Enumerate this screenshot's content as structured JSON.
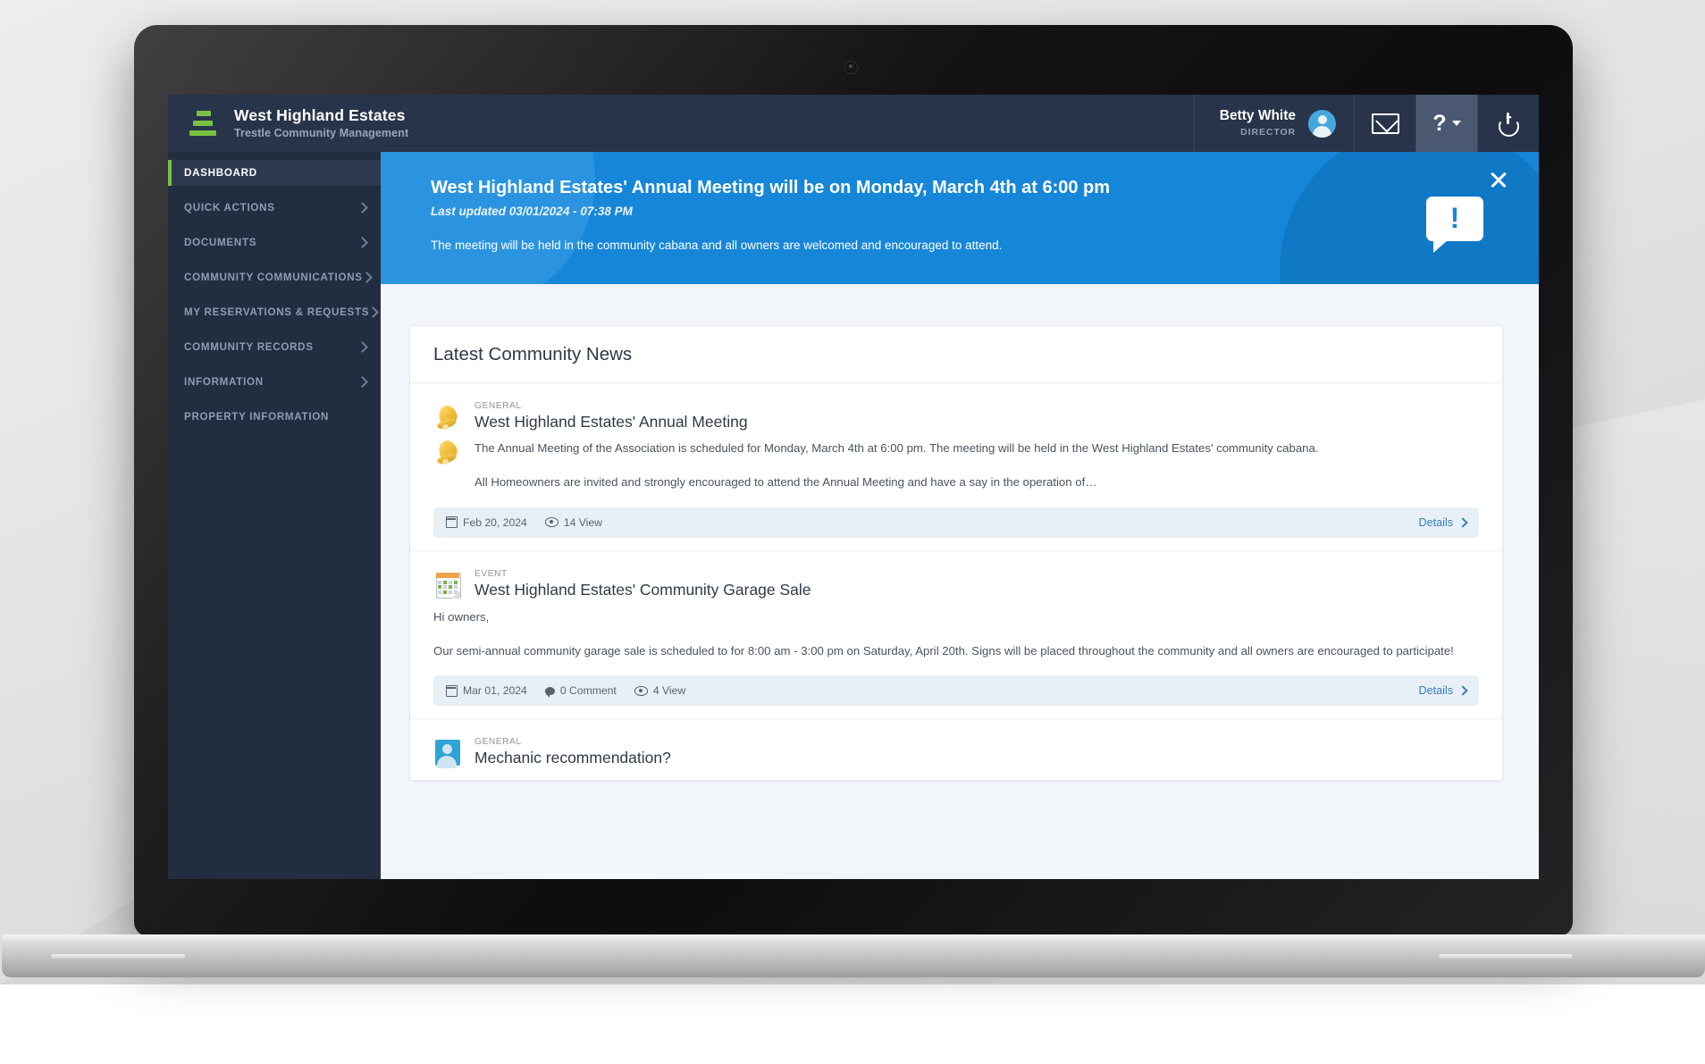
{
  "header": {
    "brand_title": "West Highland Estates",
    "brand_subtitle": "Trestle Community Management",
    "logo_icon": "trestle-bars-logo",
    "user_name": "Betty White",
    "user_role": "DIRECTOR",
    "avatar_icon": "user-avatar-icon",
    "mail_icon": "envelope-icon",
    "help_icon": "question-mark-icon",
    "help_caret_icon": "chevron-down-icon",
    "power_icon": "power-icon"
  },
  "sidebar": {
    "items": [
      {
        "label": "DASHBOARD",
        "active": true,
        "has_chevron": false
      },
      {
        "label": "QUICK ACTIONS",
        "active": false,
        "has_chevron": true
      },
      {
        "label": "DOCUMENTS",
        "active": false,
        "has_chevron": true
      },
      {
        "label": "COMMUNITY COMMUNICATIONS",
        "active": false,
        "has_chevron": true
      },
      {
        "label": "MY RESERVATIONS & REQUESTS",
        "active": false,
        "has_chevron": true
      },
      {
        "label": "COMMUNITY RECORDS",
        "active": false,
        "has_chevron": true
      },
      {
        "label": "INFORMATION",
        "active": false,
        "has_chevron": true
      },
      {
        "label": "PROPERTY INFORMATION",
        "active": false,
        "has_chevron": false
      }
    ]
  },
  "banner": {
    "title": "West Highland Estates' Annual Meeting will be on Monday, March 4th at 6:00 pm",
    "subtitle": "Last updated 03/01/2024 - 07:38 PM",
    "body": "The meeting will be held in the community cabana and all owners are welcomed and encouraged to attend.",
    "close_icon": "close-icon",
    "alert_icon": "speech-bubble-exclamation-icon",
    "alert_glyph": "!",
    "accent_color": "#1686d8"
  },
  "news": {
    "card_title": "Latest Community News",
    "articles": [
      {
        "category": "GENERAL",
        "icon": "bell-icon",
        "title": "West Highland Estates' Annual Meeting",
        "para1": "The Annual Meeting of the Association is scheduled for Monday, March 4th at 6:00 pm. The meeting will be held in the West Highland Estates' community cabana.",
        "para2": "All Homeowners are invited and strongly encouraged to attend the Annual Meeting and have a say in the operation of…",
        "date": "Feb 20, 2024",
        "views": "14 View",
        "details_label": "Details"
      },
      {
        "category": "EVENT",
        "icon": "calendar-icon",
        "title": "West Highland Estates' Community Garage Sale",
        "para1": "Hi owners,",
        "para2": "Our semi-annual community garage sale is scheduled to for 8:00 am - 3:00 pm on Saturday, April 20th. Signs will be placed throughout the community and all owners are encouraged to participate!",
        "date": "Mar 01, 2024",
        "comments": "0 Comment",
        "views": "4 View",
        "details_label": "Details"
      },
      {
        "category": "GENERAL",
        "icon": "user-avatar-icon",
        "title": "Mechanic recommendation?"
      }
    ]
  }
}
